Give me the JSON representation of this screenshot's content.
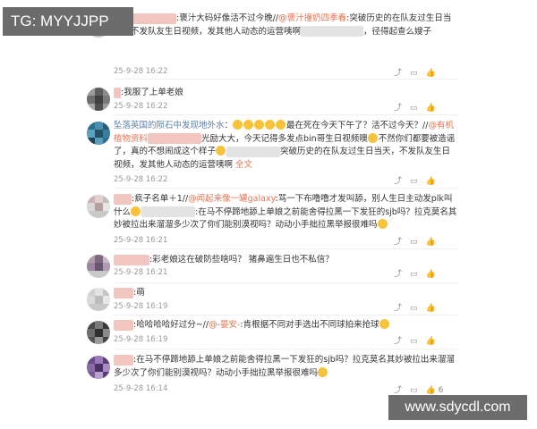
{
  "overlay": {
    "tg_label": "TG: MYYJJPP",
    "site_label": "www.sdycdl.com"
  },
  "comments": [
    {
      "pre": ":褒汁大码好像活不过今晚//",
      "mention": "@褒汁撞奶四季春",
      "body": ":突破历史的在队友过生日当天，不发队友生日视频，发其他人动态的运营咦啊",
      "tail": "，径得起查么嫂子",
      "time": "25-9-28 16:22"
    },
    {
      "body": ":我服了上单老娘",
      "time": "25-9-28 16:22"
    },
    {
      "name": "坠落英国的陨石中发现地外水",
      "pre": "：",
      "body1": "最在死在今天下午了？活不过今天？//",
      "mention": "@有机植物资料",
      "body2": "光励大大，今天记得多发点bin哥生日视频噢",
      "body3": "不然你们都要被造谣了，真的不想闹成这个样子",
      "body4": "突破历史的在队友过生日当天，不发队友生日视频，发其他人动态的运营咦啊",
      "more": "全文",
      "time": "25-9-28 16:22"
    },
    {
      "pre": ":疯子名单＋1//",
      "mention": "@闻起来像一罐galaxy",
      "body1": ":骂一下布噜噜才发叫舔，别人生日主动发plk叫什么",
      "body2": ":在马不停蹄地舔上单娘之前能舍得拉黑一下发狂的sjb吗？拉克莫名其妙被拉出来溜溜多少次了你们能别漠视吗？动动小手拙拉黑举报很难吗",
      "time": "25-9-28 16:21"
    },
    {
      "body": ":彩老娘这在破防些啥吗？ 猪鼻遍生日也不私信？",
      "time": "25-9-28 16:21"
    },
    {
      "body": ":萌",
      "time": "25-9-28 16:19"
    },
    {
      "pre": ":哈哈哈哈好过分~//",
      "mention": "@-晏安-",
      "body": ":肯根据不同对手选出不同球拍来抢球",
      "time": "25-9-28 16:19"
    },
    {
      "body": ":在马不停蹄地舔上单娘之前能舍得拉黑一下发狂的sjb吗？拉克莫名其妙被拉出来溜溜多少次了你们能别漠视吗？动动小手拙拉黑举报很难吗",
      "time": "25-9-28 16:14",
      "like_count": "6"
    }
  ],
  "colors": {
    "mention": "#eb7350",
    "username": "#5d7fab"
  }
}
